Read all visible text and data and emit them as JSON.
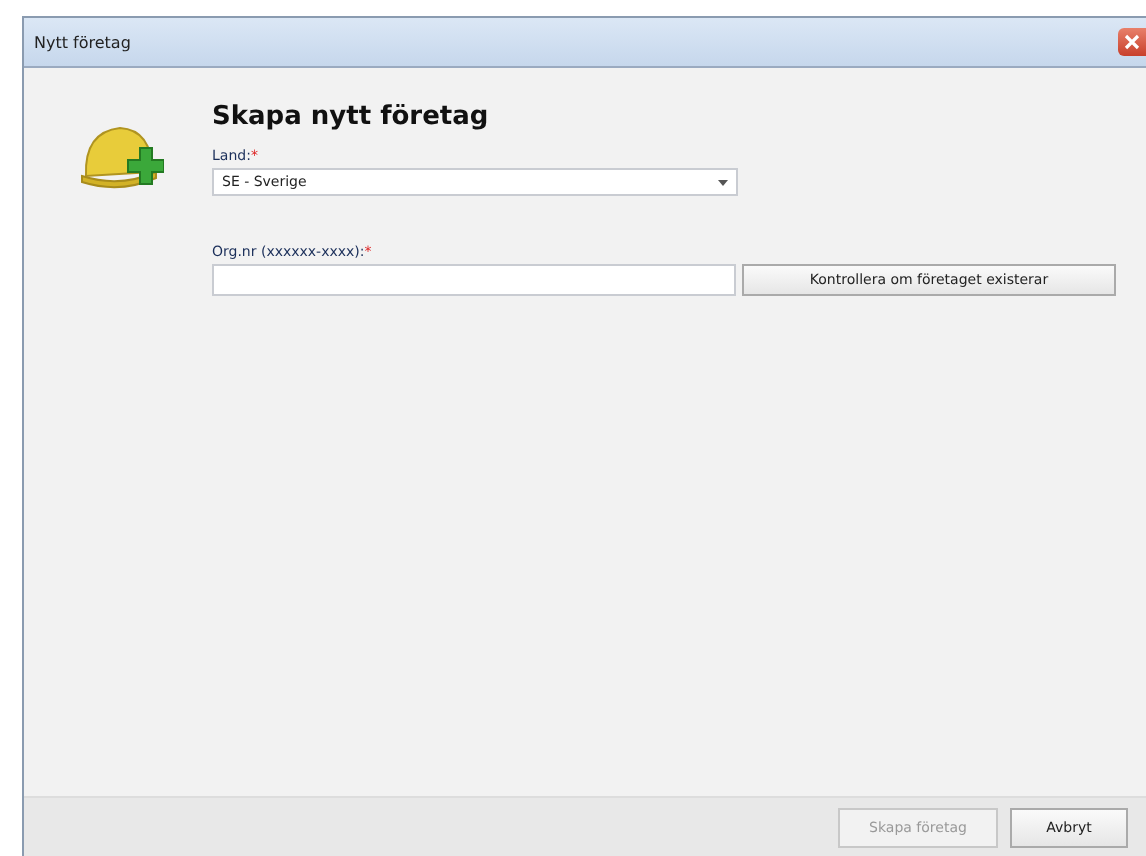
{
  "window": {
    "title": "Nytt företag"
  },
  "heading": "Skapa nytt företag",
  "country": {
    "label": "Land:",
    "required_mark": "*",
    "value": "SE - Sverige"
  },
  "org_number": {
    "label": "Org.nr (xxxxxx-xxxx):",
    "required_mark": "*",
    "check_button": {
      "label": "Kontrollera om företaget existerar",
      "disabled": false
    }
  },
  "buttons": [
    {
      "label": "Skapa företag",
      "disabled": true
    },
    {
      "label": "Avbryt",
      "disabled": false
    }
  ]
}
